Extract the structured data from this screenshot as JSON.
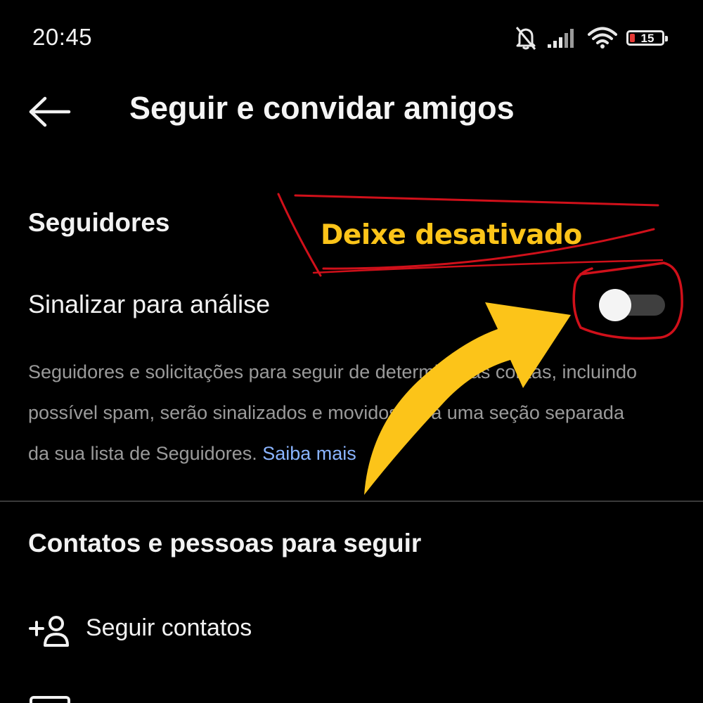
{
  "status_bar": {
    "time": "20:45",
    "battery_level": "15",
    "icons": [
      "bell-off-icon",
      "signal-icon",
      "wifi-icon",
      "battery-icon"
    ]
  },
  "header": {
    "back_icon": "arrow-left-icon",
    "title": "Seguir e convidar amigos"
  },
  "followers_section": {
    "title": "Seguidores",
    "setting": {
      "label": "Sinalizar para análise",
      "enabled": false
    },
    "description": "Seguidores e solicitações para seguir de determinadas contas, incluindo possível spam, serão sinalizados e movidos para uma seção separada da sua lista de Seguidores.",
    "learn_more": "Saiba mais"
  },
  "contacts_section": {
    "title": "Contatos e pessoas para seguir",
    "items": [
      {
        "icon": "add-person-icon",
        "label": "Seguir contatos"
      }
    ]
  },
  "annotation": {
    "text": "Deixe desativado",
    "color": "#fcc419",
    "outline_color": "#d0101a"
  }
}
